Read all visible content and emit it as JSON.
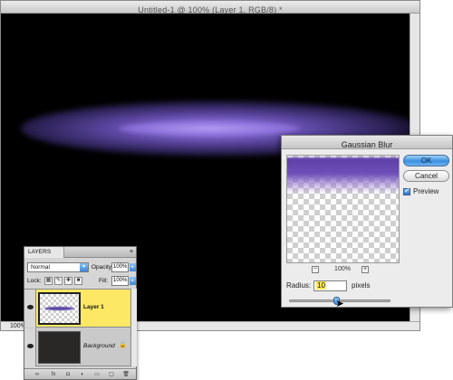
{
  "document": {
    "title": "Untitled-1 @ 100% (Layer 1, RGB/8) *",
    "zoom": "100%"
  },
  "gaussian_blur": {
    "title": "Gaussian Blur",
    "ok_label": "OK",
    "cancel_label": "Cancel",
    "preview_label": "Preview",
    "preview_checked": true,
    "preview_zoom": "100%",
    "zoom_out_glyph": "−",
    "zoom_in_glyph": "+",
    "radius_label": "Radius:",
    "radius_value": "10",
    "radius_unit": "pixels",
    "slider_fraction": 0.46,
    "accent_color": "#3c8fe0"
  },
  "layers_panel": {
    "tab_label": "LAYERS",
    "blend_mode": "Normal",
    "opacity_label": "Opacity:",
    "opacity_value": "100%",
    "lock_label": "Lock:",
    "fill_label": "Fill:",
    "fill_value": "100%",
    "layers": [
      {
        "name": "Layer 1",
        "selected": true,
        "visible": true
      },
      {
        "name": "Background",
        "selected": false,
        "visible": true,
        "locked": true
      }
    ],
    "footer_icons": [
      "link-icon",
      "fx-icon",
      "mask-icon",
      "adjustment-icon",
      "group-icon",
      "new-layer-icon",
      "trash-icon"
    ],
    "selection_color": "#fde866"
  }
}
